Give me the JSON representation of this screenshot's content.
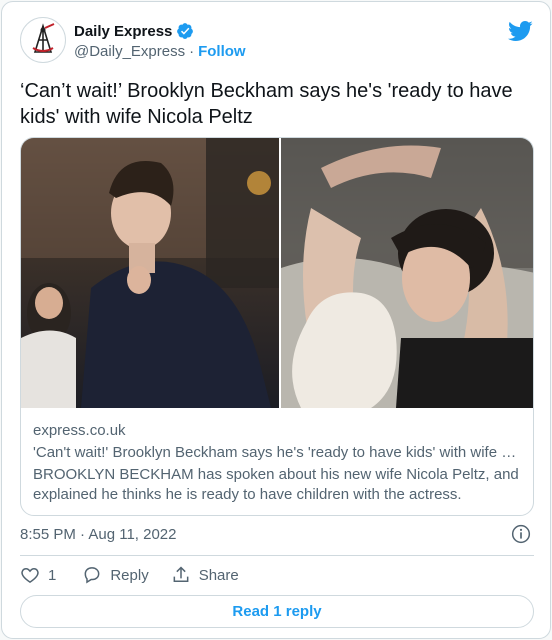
{
  "author": {
    "name": "Daily Express",
    "handle": "@Daily_Express",
    "separator": "·",
    "follow_label": "Follow"
  },
  "tweet": {
    "text": "‘Can’t wait!’ Brooklyn Beckham says he's 'ready to have kids' with wife Nicola Peltz"
  },
  "link_card": {
    "domain": "express.co.uk",
    "title": "'Can't wait!' Brooklyn Beckham says he's 'ready to have kids' with wife Nicola Peltz",
    "description": "BROOKLYN BECKHAM has spoken about his new wife Nicola Peltz, and explained he thinks he is ready to have children with the actress."
  },
  "meta": {
    "timestamp": "8:55 PM · Aug 11, 2022"
  },
  "actions": {
    "like_count": "1",
    "reply_label": "Reply",
    "share_label": "Share"
  },
  "footer": {
    "read_replies_label": "Read 1 reply"
  },
  "colors": {
    "accent": "#1d9bf0",
    "text_primary": "#0f1419",
    "text_secondary": "#536471",
    "border": "#cfd9de"
  },
  "icons": [
    "avatar-logo",
    "verified-icon",
    "twitter-bird-icon",
    "info-icon",
    "heart-icon",
    "reply-bubble-icon",
    "share-icon"
  ]
}
